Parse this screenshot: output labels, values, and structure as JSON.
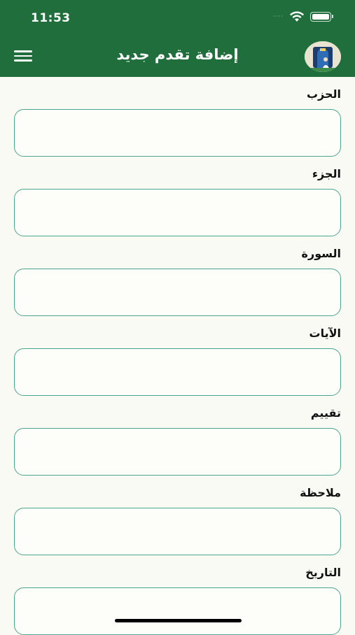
{
  "status_bar": {
    "time": "11:53",
    "cell_dots": "····"
  },
  "app_bar": {
    "title": "إضافة تقدم جديد",
    "menu_icon": "hamburger-menu-icon",
    "avatar_icon": "app-logo-avatar"
  },
  "form": {
    "fields": [
      {
        "label": "الحزب",
        "value": ""
      },
      {
        "label": "الجزء",
        "value": ""
      },
      {
        "label": "السورة",
        "value": ""
      },
      {
        "label": "الآيات",
        "value": ""
      },
      {
        "label": "تقييم",
        "value": ""
      },
      {
        "label": "ملاحظة",
        "value": ""
      },
      {
        "label": "التاريخ",
        "value": ""
      }
    ]
  },
  "colors": {
    "primary": "#1f6e3b",
    "field_border": "#4aa58f",
    "background": "#fafaf5"
  }
}
